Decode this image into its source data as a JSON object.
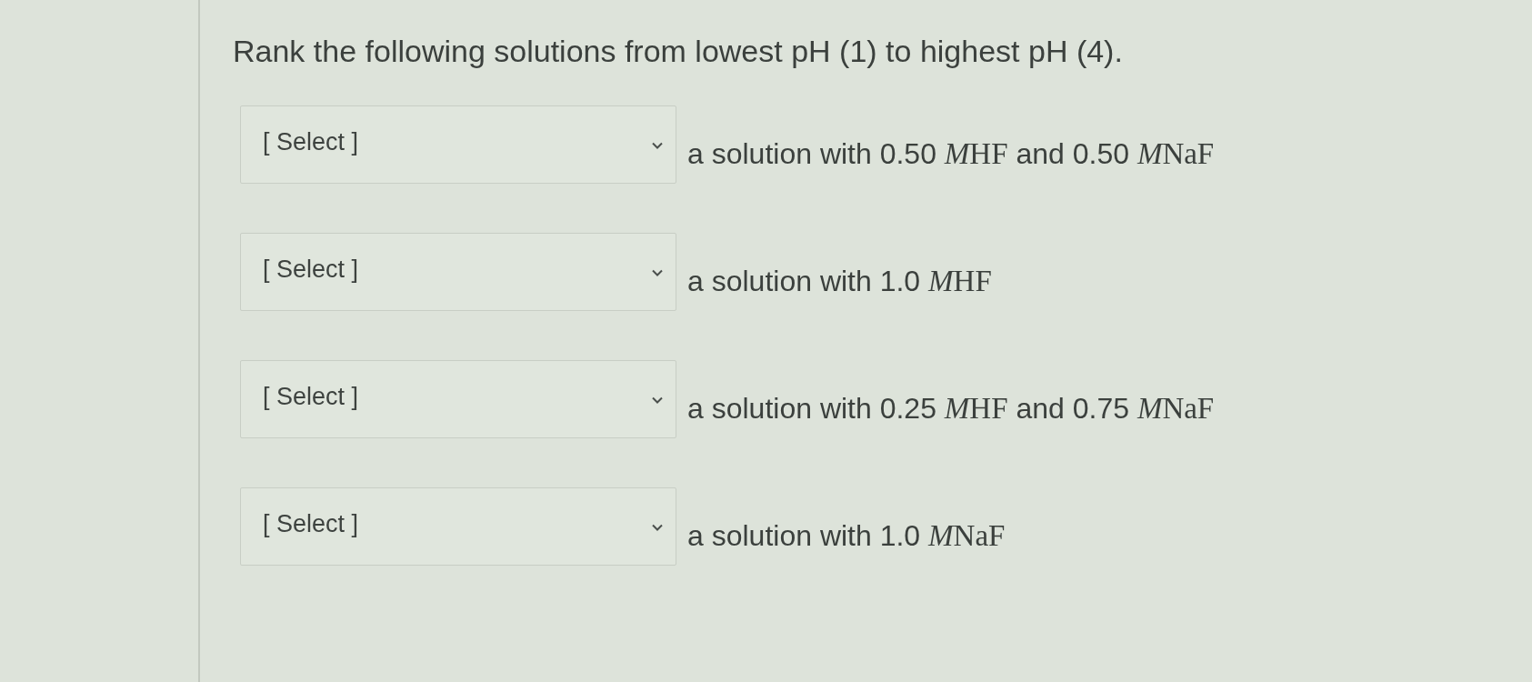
{
  "question": {
    "text": "Rank the following solutions from lowest pH (1) to highest pH (4)."
  },
  "items": [
    {
      "dropdown": {
        "value": "[ Select ]"
      },
      "label": [
        {
          "kind": "text",
          "text": "a solution with 0.50"
        },
        {
          "kind": "math",
          "symbol": "M",
          "formula": "HF"
        },
        {
          "kind": "text",
          "text": "and 0.50"
        },
        {
          "kind": "math",
          "symbol": "M",
          "formula": "NaF"
        }
      ]
    },
    {
      "dropdown": {
        "value": "[ Select ]"
      },
      "label": [
        {
          "kind": "text",
          "text": "a solution with 1.0"
        },
        {
          "kind": "math",
          "symbol": "M",
          "formula": "HF"
        }
      ]
    },
    {
      "dropdown": {
        "value": "[ Select ]"
      },
      "label": [
        {
          "kind": "text",
          "text": "a solution with 0.25"
        },
        {
          "kind": "math",
          "symbol": "M",
          "formula": "HF"
        },
        {
          "kind": "text",
          "text": "and 0.75"
        },
        {
          "kind": "math",
          "symbol": "M",
          "formula": "NaF"
        }
      ]
    },
    {
      "dropdown": {
        "value": "[ Select ]"
      },
      "label": [
        {
          "kind": "text",
          "text": "a solution with 1.0"
        },
        {
          "kind": "math",
          "symbol": "M",
          "formula": "NaF"
        }
      ]
    }
  ]
}
